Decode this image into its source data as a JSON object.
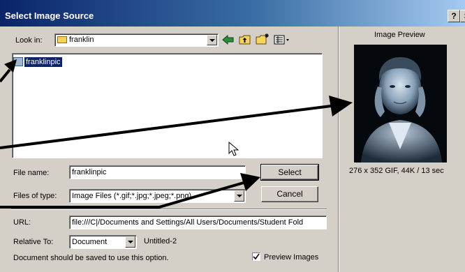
{
  "window": {
    "title": "Select Image Source",
    "help": "?",
    "close": "×"
  },
  "lookin": {
    "label": "Look in:",
    "folder": "franklin"
  },
  "files": [
    {
      "name": "franklinpic"
    }
  ],
  "filename": {
    "label": "File name:",
    "value": "franklinpic"
  },
  "filetype": {
    "label": "Files of type:",
    "value": "Image Files (*.gif;*.jpg;*.jpeg;*.png)"
  },
  "buttons": {
    "select": "Select",
    "cancel": "Cancel"
  },
  "url": {
    "label": "URL:",
    "value": "file:///C|/Documents and Settings/All Users/Documents/Student Fold"
  },
  "relative": {
    "label": "Relative To:",
    "value": "Document",
    "doc": "Untitled-2"
  },
  "note": "Document should be saved to use this option.",
  "preview": {
    "title": "Image Preview",
    "info": "276 x 352 GIF, 44K / 13 sec",
    "checkbox_label": "Preview Images",
    "checked": true
  },
  "icons": [
    "folder-icon",
    "back-arrow-icon",
    "up-folder-icon",
    "new-folder-icon",
    "view-menu-icon",
    "mouse-cursor-icon"
  ]
}
